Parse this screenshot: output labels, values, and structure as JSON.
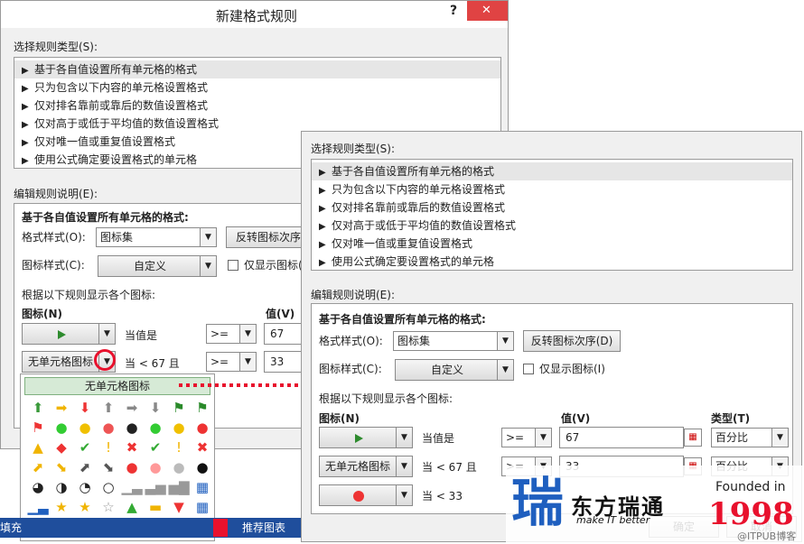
{
  "back_dialog": {
    "title": "新建格式规则",
    "help_icon": "?",
    "close_icon": "✕",
    "rule_type_label": "选择规则类型(S):",
    "rule_types": [
      "基于各自值设置所有单元格的格式",
      "只为包含以下内容的单元格设置格式",
      "仅对排名靠前或靠后的数值设置格式",
      "仅对高于或低于平均值的数值设置格式",
      "仅对唯一值或重复值设置格式",
      "使用公式确定要设置格式的单元格"
    ],
    "edit_label": "编辑规则说明(E):",
    "group_title": "基于各自值设置所有单元格的格式:",
    "format_style_label": "格式样式(O):",
    "format_style_value": "图标集",
    "reverse_button": "反转图标次序(",
    "icon_style_label": "图标样式(C):",
    "icon_style_value": "自定义",
    "show_icon_only": "仅显示图标(",
    "rule_hint": "根据以下规则显示各个图标:",
    "icon_col": "图标(N)",
    "value_col": "值(V)",
    "row1_cond": "当值是",
    "row1_op": ">=",
    "row1_value": "67",
    "row2_icon": "无单元格图标",
    "row2_cond": "当 < 67 且",
    "row2_op": ">=",
    "row2_value": "33",
    "palette_header": "无单元格图标",
    "palette_icons": [
      "⬆",
      "➡",
      "⬇",
      "⬆",
      "➡",
      "⬇",
      "⚑",
      "⚑",
      "⚑",
      "●",
      "●",
      "●",
      "●",
      "●",
      "●",
      "●",
      "▲",
      "◆",
      "✔",
      "!",
      "✖",
      "✔",
      "!",
      "✖",
      "⬈",
      "⬊",
      "⬈",
      "⬊",
      "●",
      "●",
      "●",
      "●",
      "◕",
      "◑",
      "◔",
      "○",
      "▁▃",
      "▃▅",
      "▅▇",
      "▦",
      "▁▃",
      "★",
      "★",
      "☆",
      "▲",
      "▬",
      "▼",
      "▦",
      "▦",
      "▦",
      "",
      "",
      "",
      "",
      "",
      ""
    ],
    "sheet_tab_left": "填充",
    "sheet_tab_right": "推荐图表"
  },
  "front_dialog": {
    "rule_type_label": "选择规则类型(S):",
    "rule_types": [
      "基于各自值设置所有单元格的格式",
      "只为包含以下内容的单元格设置格式",
      "仅对排名靠前或靠后的数值设置格式",
      "仅对高于或低于平均值的数值设置格式",
      "仅对唯一值或重复值设置格式",
      "使用公式确定要设置格式的单元格"
    ],
    "edit_label": "编辑规则说明(E):",
    "group_title": "基于各自值设置所有单元格的格式:",
    "format_style_label": "格式样式(O):",
    "format_style_value": "图标集",
    "reverse_button": "反转图标次序(D)",
    "icon_style_label": "图标样式(C):",
    "icon_style_value": "自定义",
    "show_icon_only": "仅显示图标(I)",
    "rule_hint": "根据以下规则显示各个图标:",
    "icon_col": "图标(N)",
    "value_col": "值(V)",
    "type_col": "类型(T)",
    "row1_cond": "当值是",
    "row1_op": ">=",
    "row1_value": "67",
    "row1_type": "百分比",
    "row2_icon": "无单元格图标",
    "row2_cond": "当 < 67 且",
    "row2_op": ">=",
    "row2_value": "33",
    "row2_type": "百分比",
    "row3_cond": "当 < 33",
    "ok_button": "确定",
    "cancel_button": "取消"
  },
  "watermark": {
    "company": "东方瑞通",
    "slogan": "make IT better",
    "founded": "Founded in",
    "year": "1998",
    "credit": "@ITPUB博客"
  },
  "colors": {
    "accent_red": "#e8112d",
    "brand_blue": "#1f5fbf",
    "tab_blue": "#1f4e9c",
    "close_red": "#e04343"
  }
}
